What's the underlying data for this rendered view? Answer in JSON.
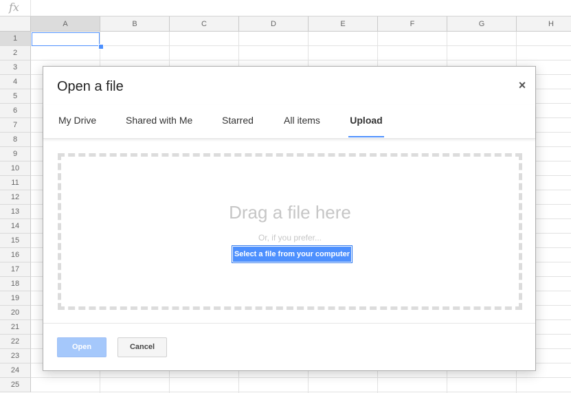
{
  "formula_bar": {
    "icon": "fx"
  },
  "spreadsheet": {
    "columns": [
      "A",
      "B",
      "C",
      "D",
      "E",
      "F",
      "G",
      "H"
    ],
    "rows": [
      "1",
      "2",
      "3",
      "4",
      "5",
      "6",
      "7",
      "8",
      "9",
      "10",
      "11",
      "12",
      "13",
      "14",
      "15",
      "16",
      "17",
      "18",
      "19",
      "20",
      "21",
      "22",
      "23",
      "24",
      "25"
    ],
    "active_cell": "A1"
  },
  "dialog": {
    "title": "Open a file",
    "close_icon": "close-icon",
    "tabs": [
      {
        "label": "My Drive",
        "active": false
      },
      {
        "label": "Shared with Me",
        "active": false
      },
      {
        "label": "Starred",
        "active": false
      },
      {
        "label": "All items",
        "active": false
      },
      {
        "label": "Upload",
        "active": true
      }
    ],
    "upload": {
      "drag_text": "Drag a file here",
      "or_text": "Or, if you prefer...",
      "select_button_label": "Select a file from your computer"
    },
    "footer": {
      "open_label": "Open",
      "cancel_label": "Cancel"
    }
  },
  "colors": {
    "accent": "#4d90fe",
    "disabled_button": "#a5c8fb",
    "drop_zone_border": "#dcdcdc"
  }
}
